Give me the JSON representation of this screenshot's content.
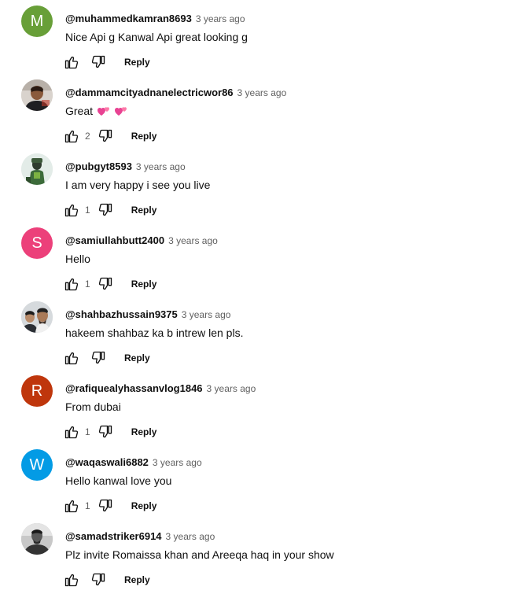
{
  "comments": [
    {
      "author": "@muhammedkamran8693",
      "time": "3 years ago",
      "text": "Nice Api g Kanwal Api great looking g",
      "likes": "",
      "reply_label": "Reply",
      "avatar": {
        "type": "letter",
        "letter": "M",
        "color": "#689f38"
      }
    },
    {
      "author": "@dammamcityadnanelectricwor86",
      "time": "3 years ago",
      "text": "Great",
      "emoji": [
        "two-hearts-emoji",
        "two-hearts-emoji"
      ],
      "likes": "2",
      "reply_label": "Reply",
      "avatar": {
        "type": "photo",
        "scene": "person-dark"
      }
    },
    {
      "author": "@pubgyt8593",
      "time": "3 years ago",
      "text": "I am very happy i see you live",
      "likes": "1",
      "reply_label": "Reply",
      "avatar": {
        "type": "photo",
        "scene": "person-green"
      }
    },
    {
      "author": "@samiullahbutt2400",
      "time": "3 years ago",
      "text": "Hello",
      "likes": "1",
      "reply_label": "Reply",
      "avatar": {
        "type": "letter",
        "letter": "S",
        "color": "#ec407a"
      }
    },
    {
      "author": "@shahbazhussain9375",
      "time": "3 years ago",
      "text": "hakeem shahbaz ka b intrew len pls.",
      "likes": "",
      "reply_label": "Reply",
      "avatar": {
        "type": "photo",
        "scene": "group"
      }
    },
    {
      "author": "@rafiquealyhassanvlog1846",
      "time": "3 years ago",
      "text": "From dubai",
      "likes": "1",
      "reply_label": "Reply",
      "avatar": {
        "type": "letter",
        "letter": "R",
        "color": "#bf360c"
      }
    },
    {
      "author": "@waqaswali6882",
      "time": "3 years ago",
      "text": "Hello kanwal love you",
      "likes": "1",
      "reply_label": "Reply",
      "avatar": {
        "type": "letter",
        "letter": "W",
        "color": "#039be5"
      }
    },
    {
      "author": "@samadstriker6914",
      "time": "3 years ago",
      "text": "Plz invite Romaissa khan and Areeqa haq in your show",
      "likes": "",
      "reply_label": "Reply",
      "avatar": {
        "type": "photo",
        "scene": "person-grey"
      }
    }
  ],
  "icons": {
    "like": "thumbs-up-icon",
    "dislike": "thumbs-down-icon"
  }
}
